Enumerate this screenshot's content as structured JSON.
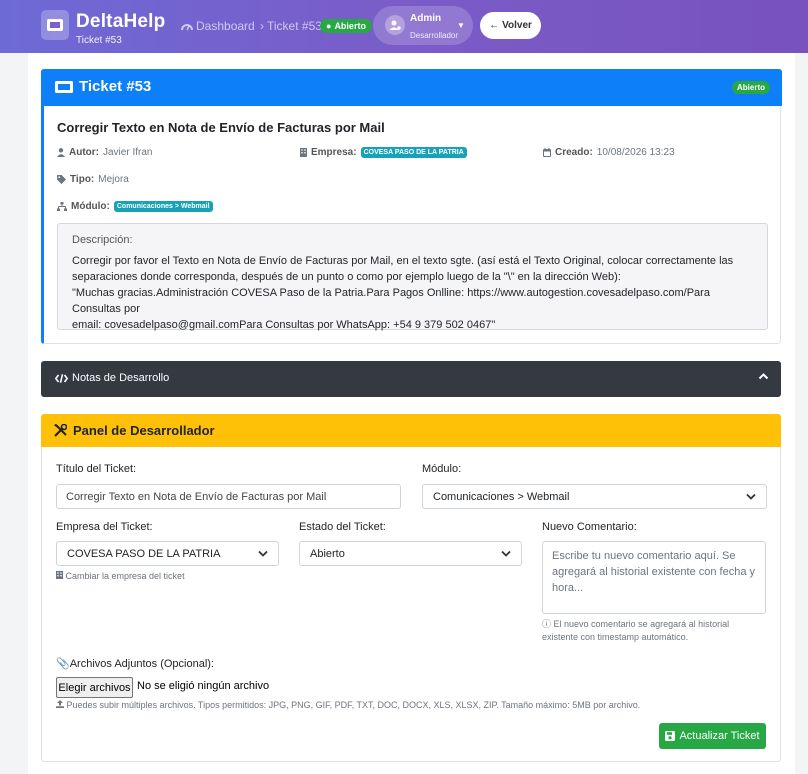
{
  "header": {
    "brand": "DeltaHelp",
    "subtitle": "Ticket #53",
    "breadcrumb": [
      "Dashboard",
      "Ticket #53"
    ],
    "status_badge": "Abierto",
    "user": {
      "name": "Admin",
      "role": "Desarrollador"
    },
    "back_label": "Volver",
    "colors": {
      "primary": "#7060cc",
      "success": "#28a745"
    }
  },
  "ticket": {
    "heading": "Ticket #53",
    "status": "Abierto",
    "subject": "Corregir Texto en Nota de Envío de Facturas por Mail",
    "author_label": "Autor:",
    "author": "Javier Ifran",
    "company_label": "Empresa:",
    "company": "COVESA PASO DE LA PATRIA",
    "created_label": "Creado:",
    "created": "10/08/2026 13:23",
    "type_label": "Tipo:",
    "type": "Mejora",
    "module_label": "Módulo:",
    "module": "Comunicaciones > Webmail",
    "description_label": "Descripción:",
    "description_lines": [
      "Corregir por favor el Texto en Nota de Envío de Facturas por Mail, en el texto sgte. (así está el Texto Original, colocar correctamente las",
      "separaciones donde corresponda, después de un punto o como por ejemplo luego de la \"\\\" en la dirección Web):",
      "\"Muchas gracias.Administración COVESA Paso de la Patria.Para Pagos Onlline: https://www.autogestion.covesadelpaso.com/Para Consultas por",
      "email: covesadelpaso@gmail.comPara Consultas por WhatsApp: +54 9 379 502 0467\""
    ],
    "colors": {
      "header": "#0d7ff9",
      "badge": "#17a2b8"
    }
  },
  "dev_notes": {
    "title": "Notas de Desarrollo"
  },
  "dev_panel": {
    "title": "Panel de Desarrollador",
    "title_label": "Título del Ticket:",
    "title_value": "Corregir Texto en Nota de Envío de Facturas por Mail",
    "module_label": "Módulo:",
    "module_value": "Comunicaciones > Webmail",
    "company_label": "Empresa del Ticket:",
    "company_value": "COVESA PASO DE LA PATRIA",
    "company_help": "Cambiar la empresa del ticket",
    "status_label": "Estado del Ticket:",
    "status_value": "Abierto",
    "comment_label": "Nuevo Comentario:",
    "comment_placeholder": "Escribe tu nuevo comentario aquí. Se agregará al historial existente con fecha y hora...",
    "comment_help": "El nuevo comentario se agregará al historial existente con timestamp automático.",
    "files_label": "Archivos Adjuntos (Opcional):",
    "file_button": "Elegir archivos",
    "file_none": "No se eligió ningún archivo",
    "files_help": "Puedes subir múltiples archivos. Tipos permitidos: JPG, PNG, GIF, PDF, TXT, DOC, DOCX, XLS, XLSX, ZIP. Tamaño máximo: 5MB por archivo.",
    "update_button": "Actualizar Ticket",
    "colors": {
      "header": "#ffc107",
      "button": "#28a745"
    }
  }
}
